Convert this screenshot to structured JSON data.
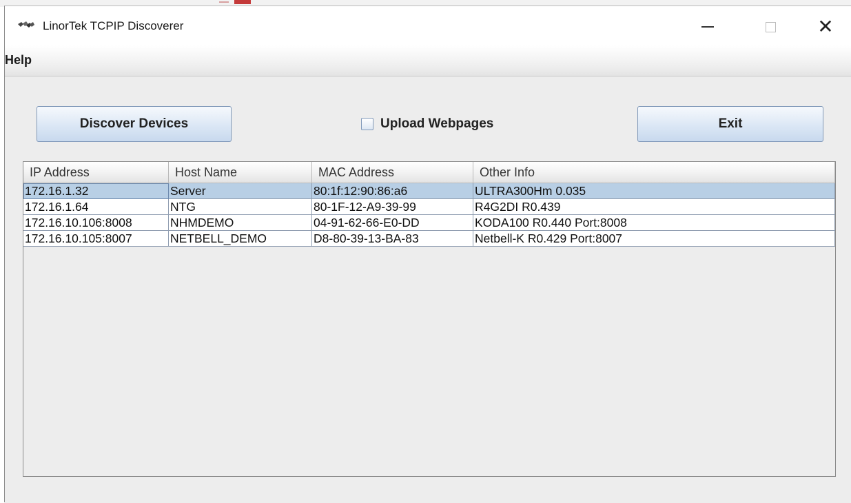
{
  "window": {
    "title": "LinorTek TCPIP Discoverer",
    "controls": {
      "minimize": "—",
      "maximize": "☐",
      "close": "✕"
    },
    "icon": "network-icon"
  },
  "menu": {
    "help": "Help"
  },
  "toolbar": {
    "discover_label": "Discover Devices",
    "upload_label": "Upload Webpages",
    "upload_checked": false,
    "exit_label": "Exit"
  },
  "table": {
    "columns": [
      "IP Address",
      "Host Name",
      "MAC Address",
      "Other Info"
    ],
    "rows": [
      [
        "172.16.1.32",
        "Server",
        "80:1f:12:90:86:a6",
        "ULTRA300Hm 0.035"
      ],
      [
        "172.16.1.64",
        "NTG",
        "80-1F-12-A9-39-99",
        "R4G2DI R0.439"
      ],
      [
        "172.16.10.106:8008",
        "NHMDEMO",
        "04-91-62-66-E0-DD",
        "KODA100 R0.440  Port:8008"
      ],
      [
        "172.16.10.105:8007",
        "NETBELL_DEMO",
        "D8-80-39-13-BA-83",
        "Netbell-K R0.429  Port:8007"
      ]
    ],
    "selected_row": 0
  },
  "colors": {
    "selection": "#b8cfe5",
    "button_gradient_top": "#f6f9fd",
    "button_gradient_bottom": "#c8d9ee",
    "panel": "#ededed"
  }
}
